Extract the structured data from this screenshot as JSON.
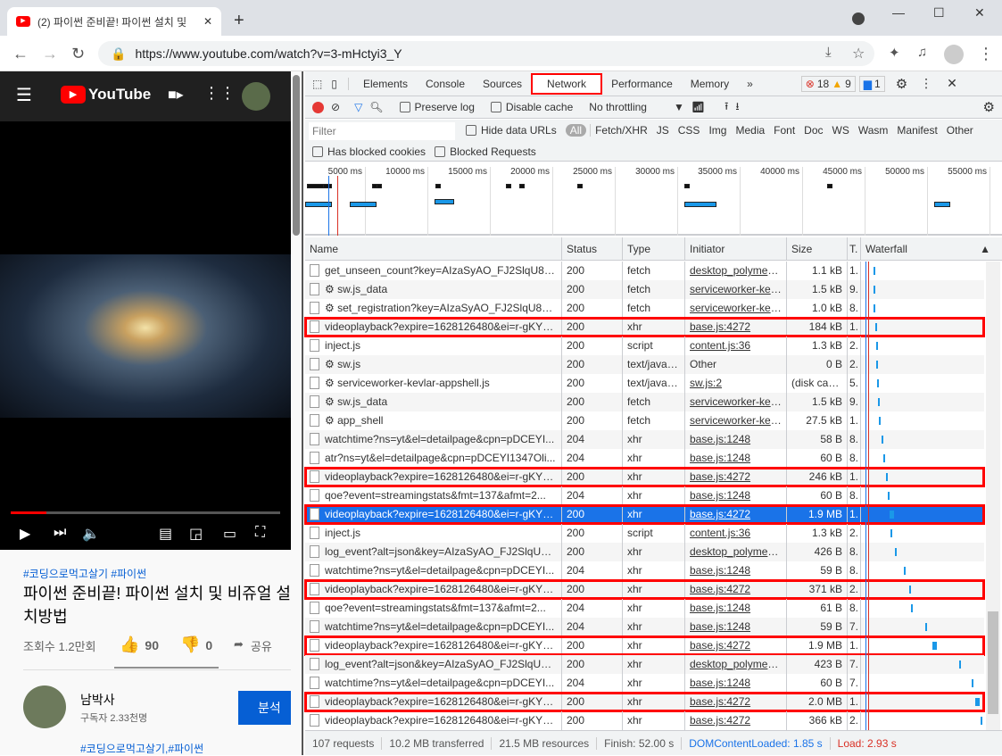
{
  "browser": {
    "tab_title": "(2) 파이썬 준비끝! 파이썬 설치 및",
    "url": "https://www.youtube.com/watch?v=3-mHctyi3_Y"
  },
  "youtube": {
    "logo": "YouTube",
    "tags": "#코딩으로먹고살기 #파이썬",
    "title": "파이썬 준비끝! 파이썬 설치 및 비쥬얼 설치방법",
    "views": "조회수 1.2만회",
    "likes": "90",
    "dislikes": "0",
    "share": "공유",
    "channel": "남박사",
    "subscribers": "구독자 2.33천명",
    "subscribe_label": "분석",
    "desc_tags": "#코딩으로먹고살기,#파이썬"
  },
  "devtools": {
    "tabs": [
      "Elements",
      "Console",
      "Sources",
      "Network",
      "Performance",
      "Memory"
    ],
    "active_tab": "Network",
    "errors": "18",
    "warnings": "9",
    "messages": "1",
    "preserve_log": "Preserve log",
    "disable_cache": "Disable cache",
    "throttling": "No throttling",
    "filter_placeholder": "Filter",
    "hide_data_urls": "Hide data URLs",
    "filter_types": [
      "All",
      "Fetch/XHR",
      "JS",
      "CSS",
      "Img",
      "Media",
      "Font",
      "Doc",
      "WS",
      "Wasm",
      "Manifest",
      "Other"
    ],
    "has_blocked_cookies": "Has blocked cookies",
    "blocked_requests": "Blocked Requests",
    "overview_ticks": [
      "5000 ms",
      "10000 ms",
      "15000 ms",
      "20000 ms",
      "25000 ms",
      "30000 ms",
      "35000 ms",
      "40000 ms",
      "45000 ms",
      "50000 ms",
      "55000 ms"
    ],
    "columns": [
      "Name",
      "Status",
      "Type",
      "Initiator",
      "Size",
      "T.",
      "Waterfall"
    ],
    "rows": [
      {
        "name": "get_unseen_count?key=AIzaSyAO_FJ2SlqU8Q4...",
        "status": "200",
        "type": "fetch",
        "initiator": "desktop_polymer_...",
        "size": "1.1 kB",
        "time": "1."
      },
      {
        "name": "⚙ sw.js_data",
        "status": "200",
        "type": "fetch",
        "initiator": "serviceworker-kev...",
        "size": "1.5 kB",
        "time": "9."
      },
      {
        "name": "⚙ set_registration?key=AIzaSyAO_FJ2SlqU8Q4...",
        "status": "200",
        "type": "fetch",
        "initiator": "serviceworker-kev...",
        "size": "1.0 kB",
        "time": "8."
      },
      {
        "name": "videoplayback?expire=1628126480&ei=r-gKYd...",
        "status": "200",
        "type": "xhr",
        "initiator": "base.js:4272",
        "size": "184 kB",
        "time": "1.",
        "hl": true
      },
      {
        "name": "inject.js",
        "status": "200",
        "type": "script",
        "initiator": "content.js:36",
        "size": "1.3 kB",
        "time": "2."
      },
      {
        "name": "⚙ sw.js",
        "status": "200",
        "type": "text/javas...",
        "initiator": "Other",
        "size": "0 B",
        "time": "2."
      },
      {
        "name": "⚙ serviceworker-kevlar-appshell.js",
        "status": "200",
        "type": "text/javas...",
        "initiator": "sw.js:2",
        "size": "(disk cac...",
        "time": "5."
      },
      {
        "name": "⚙ sw.js_data",
        "status": "200",
        "type": "fetch",
        "initiator": "serviceworker-kev...",
        "size": "1.5 kB",
        "time": "9."
      },
      {
        "name": "⚙ app_shell",
        "status": "200",
        "type": "fetch",
        "initiator": "serviceworker-kev...",
        "size": "27.5 kB",
        "time": "1."
      },
      {
        "name": "watchtime?ns=yt&el=detailpage&cpn=pDCEYI...",
        "status": "204",
        "type": "xhr",
        "initiator": "base.js:1248",
        "size": "58 B",
        "time": "8."
      },
      {
        "name": "atr?ns=yt&el=detailpage&cpn=pDCEYI1347Oli...",
        "status": "204",
        "type": "xhr",
        "initiator": "base.js:1248",
        "size": "60 B",
        "time": "8."
      },
      {
        "name": "videoplayback?expire=1628126480&ei=r-gKYd...",
        "status": "200",
        "type": "xhr",
        "initiator": "base.js:4272",
        "size": "246 kB",
        "time": "1.",
        "hl": true
      },
      {
        "name": "qoe?event=streamingstats&fmt=137&afmt=2...",
        "status": "204",
        "type": "xhr",
        "initiator": "base.js:1248",
        "size": "60 B",
        "time": "8."
      },
      {
        "name": "videoplayback?expire=1628126480&ei=r-gKYd...",
        "status": "200",
        "type": "xhr",
        "initiator": "base.js:4272",
        "size": "1.9 MB",
        "time": "1.",
        "hl": true,
        "sel": true
      },
      {
        "name": "inject.js",
        "status": "200",
        "type": "script",
        "initiator": "content.js:36",
        "size": "1.3 kB",
        "time": "2."
      },
      {
        "name": "log_event?alt=json&key=AIzaSyAO_FJ2SlqU8Q...",
        "status": "200",
        "type": "xhr",
        "initiator": "desktop_polymer_...",
        "size": "426 B",
        "time": "8."
      },
      {
        "name": "watchtime?ns=yt&el=detailpage&cpn=pDCEYI...",
        "status": "204",
        "type": "xhr",
        "initiator": "base.js:1248",
        "size": "59 B",
        "time": "8."
      },
      {
        "name": "videoplayback?expire=1628126480&ei=r-gKYd...",
        "status": "200",
        "type": "xhr",
        "initiator": "base.js:4272",
        "size": "371 kB",
        "time": "2.",
        "hl": true
      },
      {
        "name": "qoe?event=streamingstats&fmt=137&afmt=2...",
        "status": "204",
        "type": "xhr",
        "initiator": "base.js:1248",
        "size": "61 B",
        "time": "8."
      },
      {
        "name": "watchtime?ns=yt&el=detailpage&cpn=pDCEYI...",
        "status": "204",
        "type": "xhr",
        "initiator": "base.js:1248",
        "size": "59 B",
        "time": "7."
      },
      {
        "name": "videoplayback?expire=1628126480&ei=r-gKYd...",
        "status": "200",
        "type": "xhr",
        "initiator": "base.js:4272",
        "size": "1.9 MB",
        "time": "1.",
        "hl": true
      },
      {
        "name": "log_event?alt=json&key=AIzaSyAO_FJ2SlqU8Q...",
        "status": "200",
        "type": "xhr",
        "initiator": "desktop_polymer_...",
        "size": "423 B",
        "time": "7."
      },
      {
        "name": "watchtime?ns=yt&el=detailpage&cpn=pDCEYI...",
        "status": "204",
        "type": "xhr",
        "initiator": "base.js:1248",
        "size": "60 B",
        "time": "7."
      },
      {
        "name": "videoplayback?expire=1628126480&ei=r-gKYd...",
        "status": "200",
        "type": "xhr",
        "initiator": "base.js:4272",
        "size": "2.0 MB",
        "time": "1.",
        "hl": true
      },
      {
        "name": "videoplayback?expire=1628126480&ei=r-gKYd...",
        "status": "200",
        "type": "xhr",
        "initiator": "base.js:4272",
        "size": "366 kB",
        "time": "2."
      }
    ],
    "footer": {
      "requests": "107 requests",
      "transferred": "10.2 MB transferred",
      "resources": "21.5 MB resources",
      "finish": "Finish: 52.00 s",
      "dcl": "DOMContentLoaded: 1.85 s",
      "load": "Load: 2.93 s"
    }
  }
}
